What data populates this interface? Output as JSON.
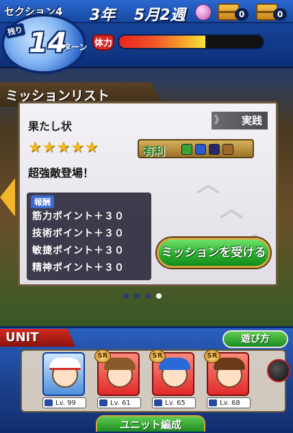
{
  "hud": {
    "section": "セクション4",
    "year": "3年",
    "month_week": "5月2週",
    "remaining_label": "残り",
    "turns": "14",
    "turn_unit": "ターン",
    "hp_label": "体力",
    "hp_fraction": 0.6,
    "chest_counts": [
      "0",
      "0"
    ]
  },
  "mission_panel": {
    "title": "ミッションリスト",
    "mission_name": "果たし状",
    "tag": "実践",
    "stars": "★★★★★",
    "advantage_label": "有利",
    "description": "超強敵登場！",
    "reward_header": "報酬",
    "rewards": [
      "筋力ポイント＋３０",
      "技術ポイント＋３０",
      "敏捷ポイント＋３０",
      "精神ポイント＋３０"
    ],
    "accept_button": "ミッションを受ける",
    "page_count": 4,
    "active_page": 4
  },
  "unit": {
    "label": "UNIT",
    "play_button": "遊び方",
    "members": [
      {
        "rank": "",
        "level": "Lv. 99"
      },
      {
        "rank": "SR",
        "level": "Lv. 61"
      },
      {
        "rank": "SR",
        "level": "Lv. 65"
      },
      {
        "rank": "SR",
        "level": "Lv. 68"
      }
    ],
    "bottom_button": "ユニット編成"
  },
  "colors": {
    "accent_blue": "#1d4fa8",
    "accept_green": "#2bb02f",
    "unit_red": "#d22a20"
  }
}
